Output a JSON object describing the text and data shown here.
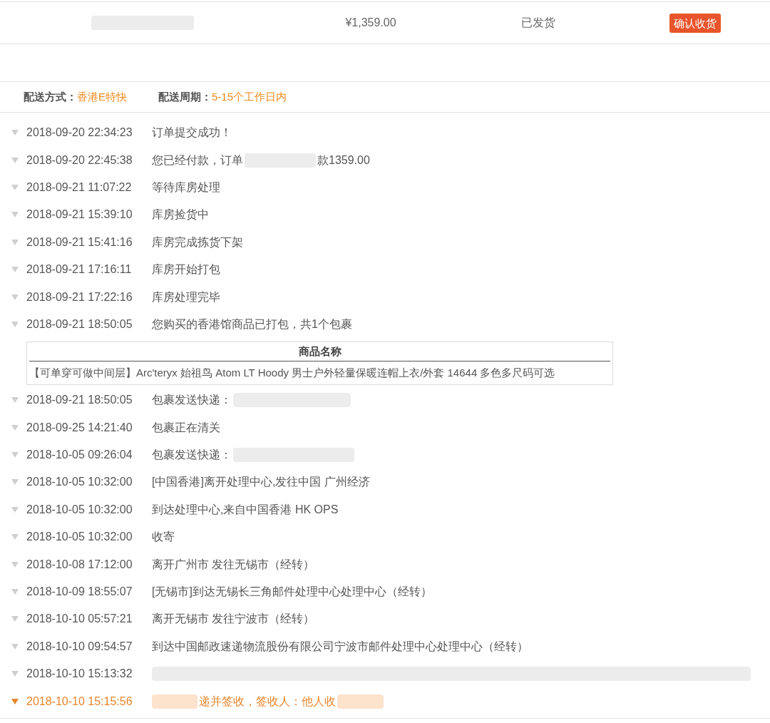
{
  "order_row": {
    "product": {
      "kind": "redacted"
    },
    "price": "¥1,359.00",
    "status": "已发货",
    "action_button": "确认收货"
  },
  "delivery": [
    {
      "label": "配送方式：",
      "value": "香港E特快"
    },
    {
      "label": "配送周期：",
      "value": "5-15个工作日内"
    }
  ],
  "timeline": [
    {
      "time": "2018-09-20 22:34:23",
      "latest": false,
      "parts": [
        {
          "kind": "text",
          "text": "订单提交成功！"
        }
      ]
    },
    {
      "time": "2018-09-20 22:45:38",
      "latest": false,
      "parts": [
        {
          "kind": "text",
          "text": "您已经付款，订单"
        },
        {
          "kind": "redacted"
        },
        {
          "kind": "text",
          "text": "款1359.00"
        }
      ]
    },
    {
      "time": "2018-09-21 11:07:22",
      "latest": false,
      "parts": [
        {
          "kind": "text",
          "text": "等待库房处理"
        }
      ]
    },
    {
      "time": "2018-09-21 15:39:10",
      "latest": false,
      "parts": [
        {
          "kind": "text",
          "text": "库房捡货中"
        }
      ]
    },
    {
      "time": "2018-09-21 15:41:16",
      "latest": false,
      "parts": [
        {
          "kind": "text",
          "text": "库房完成拣货下架"
        }
      ]
    },
    {
      "time": "2018-09-21 17:16:11",
      "latest": false,
      "parts": [
        {
          "kind": "text",
          "text": "库房开始打包"
        }
      ]
    },
    {
      "time": "2018-09-21 17:22:16",
      "latest": false,
      "parts": [
        {
          "kind": "text",
          "text": "库房处理完毕"
        }
      ]
    },
    {
      "time": "2018-09-21 18:50:05",
      "latest": false,
      "parts": [
        {
          "kind": "text",
          "text": "您购买的香港馆商品已打包，共1个包裹"
        }
      ],
      "package_table": {
        "columns": [
          "商品名称"
        ],
        "rows": [
          [
            "【可单穿可做中间层】Arc'teryx 始祖鸟 Atom LT Hoody 男士户外轻量保暖连帽上衣/外套 14644 多色多尺码可选"
          ]
        ]
      }
    },
    {
      "time": "2018-09-21 18:50:05",
      "latest": false,
      "parts": [
        {
          "kind": "text",
          "text": "包裹发送快递："
        },
        {
          "kind": "redacted"
        }
      ]
    },
    {
      "time": "2018-09-25 14:21:40",
      "latest": false,
      "parts": [
        {
          "kind": "text",
          "text": "包裹正在清关"
        }
      ]
    },
    {
      "time": "2018-10-05 09:26:04",
      "latest": false,
      "parts": [
        {
          "kind": "text",
          "text": "包裹发送快递："
        },
        {
          "kind": "redacted"
        }
      ]
    },
    {
      "time": "2018-10-05 10:32:00",
      "latest": false,
      "parts": [
        {
          "kind": "text",
          "text": "[中国香港]离开处理中心,发往中国 广州经济"
        }
      ]
    },
    {
      "time": "2018-10-05 10:32:00",
      "latest": false,
      "parts": [
        {
          "kind": "text",
          "text": "到达处理中心,来自中国香港 HK OPS"
        }
      ]
    },
    {
      "time": "2018-10-05 10:32:00",
      "latest": false,
      "parts": [
        {
          "kind": "text",
          "text": "收寄"
        }
      ]
    },
    {
      "time": "2018-10-08 17:12:00",
      "latest": false,
      "parts": [
        {
          "kind": "text",
          "text": "离开广州市 发往无锡市（经转）"
        }
      ]
    },
    {
      "time": "2018-10-09 18:55:07",
      "latest": false,
      "parts": [
        {
          "kind": "text",
          "text": "[无锡市]到达无锡长三角邮件处理中心处理中心（经转）"
        }
      ]
    },
    {
      "time": "2018-10-10 05:57:21",
      "latest": false,
      "parts": [
        {
          "kind": "text",
          "text": "离开无锡市 发往宁波市（经转）"
        }
      ]
    },
    {
      "time": "2018-10-10 09:54:57",
      "latest": false,
      "parts": [
        {
          "kind": "text",
          "text": "到达中国邮政速递物流股份有限公司宁波市邮件处理中心处理中心（经转）"
        }
      ]
    },
    {
      "time": "2018-10-10 15:13:32",
      "latest": false,
      "parts": [
        {
          "kind": "redacted"
        }
      ]
    },
    {
      "time": "2018-10-10 15:15:56",
      "latest": true,
      "parts": [
        {
          "kind": "redacted"
        },
        {
          "kind": "text",
          "text": "递并签收，签收人：他人收"
        },
        {
          "kind": "redacted"
        }
      ]
    }
  ]
}
